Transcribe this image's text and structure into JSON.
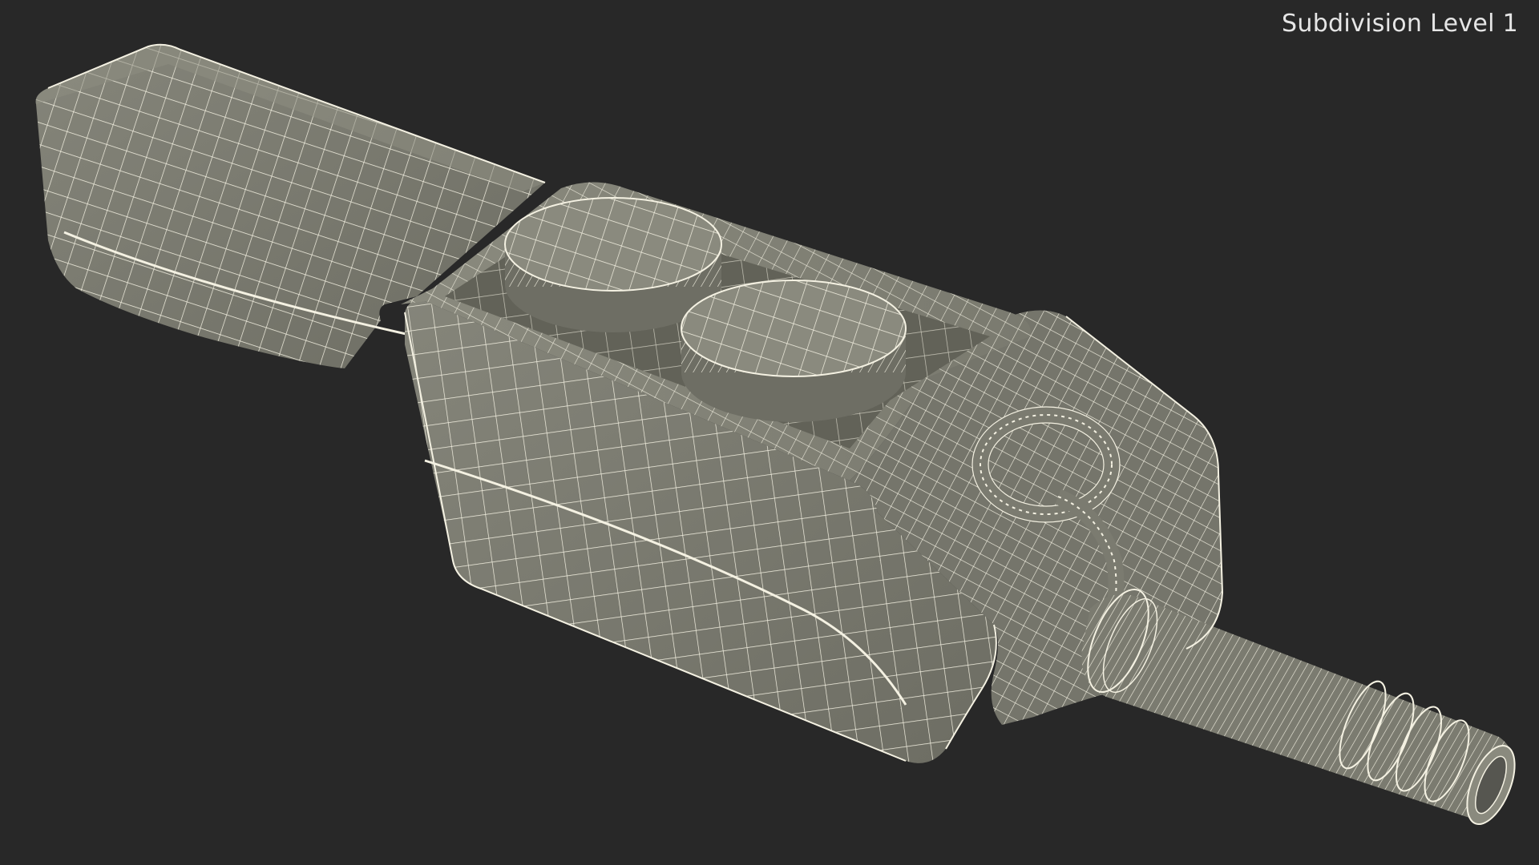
{
  "viewport": {
    "label": "Subdivision Level 1"
  },
  "model": {
    "render_mode": "wireframe-on-shaded",
    "subject": "pendant-control-two-button",
    "colors": {
      "background": "#282828",
      "surface": "#7b7b70",
      "surface_shadow": "#626258",
      "surface_light": "#8e8e82",
      "wire": "#f4f1e2"
    }
  }
}
